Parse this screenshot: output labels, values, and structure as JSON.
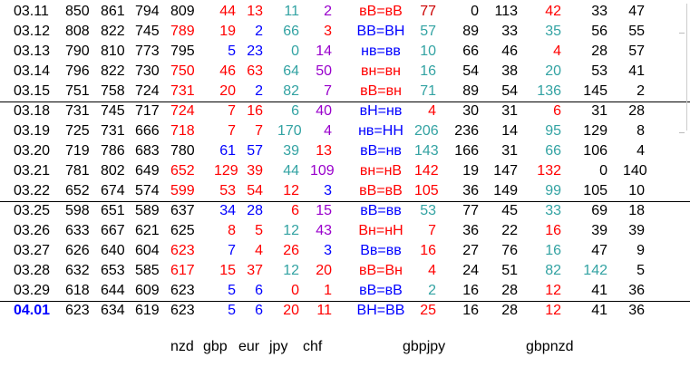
{
  "colors": {
    "black": "#000000",
    "red": "#ff0000",
    "blue": "#0000ff",
    "teal": "#33a3a3",
    "purple": "#9900cc",
    "darkred": "#cc0000"
  },
  "rows": [
    {
      "cells": [
        "03.11",
        "850",
        "861",
        "794",
        "809",
        "44",
        "13",
        "11",
        "2",
        "вВ=вВ",
        "77",
        "0",
        "113",
        "42",
        "33",
        "47"
      ]
    },
    {
      "cells": [
        "03.12",
        "808",
        "822",
        "745",
        "789",
        "19",
        "2",
        "66",
        "3",
        "ВВ=ВН",
        "57",
        "89",
        "33",
        "35",
        "56",
        "55"
      ]
    },
    {
      "cells": [
        "03.13",
        "790",
        "810",
        "773",
        "795",
        "5",
        "23",
        "0",
        "14",
        "нв=вв",
        "10",
        "66",
        "46",
        "4",
        "28",
        "57"
      ]
    },
    {
      "cells": [
        "03.14",
        "796",
        "822",
        "730",
        "750",
        "46",
        "63",
        "64",
        "50",
        "вн=вн",
        "16",
        "54",
        "38",
        "20",
        "53",
        "41"
      ]
    },
    {
      "cells": [
        "03.15",
        "751",
        "758",
        "724",
        "731",
        "20",
        "2",
        "82",
        "7",
        "вВ=вн",
        "71",
        "89",
        "54",
        "136",
        "145",
        "2"
      ]
    },
    {
      "cells": [
        "03.18",
        "731",
        "745",
        "717",
        "724",
        "7",
        "16",
        "6",
        "40",
        "вН=нв",
        "4",
        "30",
        "31",
        "6",
        "31",
        "28"
      ]
    },
    {
      "cells": [
        "03.19",
        "725",
        "731",
        "666",
        "718",
        "7",
        "7",
        "170",
        "4",
        "нв=НН",
        "206",
        "236",
        "14",
        "95",
        "129",
        "8"
      ]
    },
    {
      "cells": [
        "03.20",
        "719",
        "786",
        "683",
        "780",
        "61",
        "57",
        "39",
        "13",
        "вВ=нв",
        "143",
        "166",
        "31",
        "66",
        "106",
        "4"
      ]
    },
    {
      "cells": [
        "03.21",
        "781",
        "802",
        "649",
        "652",
        "129",
        "39",
        "44",
        "109",
        "вн=нВ",
        "142",
        "19",
        "147",
        "132",
        "0",
        "140"
      ]
    },
    {
      "cells": [
        "03.22",
        "652",
        "674",
        "574",
        "599",
        "53",
        "54",
        "12",
        "3",
        "вВ=вВ",
        "105",
        "36",
        "149",
        "99",
        "105",
        "10"
      ]
    },
    {
      "cells": [
        "03.25",
        "598",
        "651",
        "589",
        "637",
        "34",
        "28",
        "6",
        "15",
        "вВ=вв",
        "53",
        "77",
        "45",
        "33",
        "69",
        "18"
      ]
    },
    {
      "cells": [
        "03.26",
        "633",
        "667",
        "621",
        "625",
        "8",
        "5",
        "12",
        "43",
        "Вн=нН",
        "7",
        "36",
        "22",
        "16",
        "39",
        "39"
      ]
    },
    {
      "cells": [
        "03.27",
        "626",
        "640",
        "604",
        "623",
        "7",
        "4",
        "26",
        "3",
        "Вв=вв",
        "16",
        "27",
        "76",
        "16",
        "47",
        "9"
      ]
    },
    {
      "cells": [
        "03.28",
        "632",
        "653",
        "585",
        "617",
        "15",
        "37",
        "12",
        "20",
        "вВ=Вн",
        "4",
        "24",
        "51",
        "82",
        "142",
        "5"
      ]
    },
    {
      "cells": [
        "03.29",
        "618",
        "644",
        "609",
        "623",
        "5",
        "6",
        "0",
        "1",
        "вВ=вВ",
        "2",
        "16",
        "28",
        "12",
        "41",
        "36"
      ]
    },
    {
      "cells": [
        "04.01",
        "623",
        "634",
        "619",
        "623",
        "5",
        "6",
        "20",
        "11",
        "ВН=ВВ",
        "25",
        "16",
        "28",
        "12",
        "41",
        "36"
      ]
    }
  ],
  "column_labels": [
    "nzd",
    "gbp",
    "eur",
    "jpy",
    "chf",
    "gbpjpy",
    "gbpnzd"
  ]
}
